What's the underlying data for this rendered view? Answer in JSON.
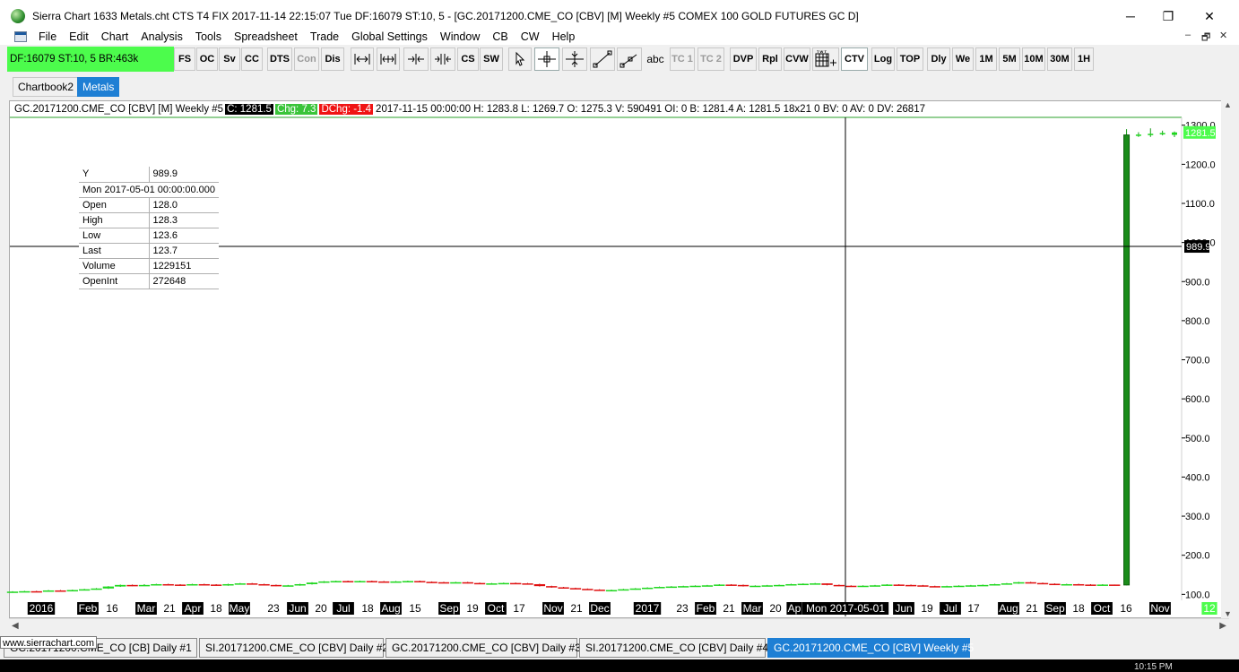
{
  "window": {
    "title": "Sierra Chart 1633 Metals.cht  CTS T4 FIX 2017-11-14  22:15:07 Tue  DF:16079  ST:10, 5 - [GC.20171200.CME_CO [CBV] [M]  Weekly  #5  COMEX 100 GOLD FUTURES GC D]",
    "minimize": "─",
    "maximize": "❐",
    "close": "✕"
  },
  "menu": [
    "File",
    "Edit",
    "Chart",
    "Analysis",
    "Tools",
    "Spreadsheet",
    "Trade",
    "Global Settings",
    "Window",
    "CB",
    "CW",
    "Help"
  ],
  "mdi_controls": [
    "–",
    "🗗",
    "✕"
  ],
  "status_box": "DF:16079  ST:10, 5  BR:463k",
  "toolbar": {
    "buttons": [
      "FS",
      "OC",
      "Sv",
      "CC",
      "DTS",
      "Con",
      "Dis",
      "CS",
      "SW",
      "abc",
      "TC 1",
      "TC 2",
      "DVP",
      "Rpl",
      "CVW",
      "CTV",
      "Log",
      "TOP",
      "Dly",
      "We",
      "1M",
      "5M",
      "10M",
      "30M",
      "1H"
    ],
    "disabled": [
      "Con",
      "TC 1",
      "TC 2"
    ],
    "selected": [
      "CTV"
    ],
    "icons": [
      "fit-width-icon",
      "expand-width-icon",
      "scale-left-icon",
      "scale-right-icon",
      "pointer-icon",
      "crosshair-icon",
      "value-crosshair-icon",
      "line-icon",
      "ray-icon",
      "calendar-icon"
    ]
  },
  "chartbook_tabs": [
    {
      "label": "Chartbook2",
      "active": false
    },
    {
      "label": "Metals",
      "active": true
    }
  ],
  "header": {
    "symbol": "GC.20171200.CME_CO [CBV] [M]  Weekly  #5",
    "close": "C: 1281.5",
    "change": "Chg: 7.3",
    "dchange": "DChg: -1.4",
    "rest": "2017-11-15 00:00:00 H: 1283.8 L: 1269.7 O: 1275.3 V: 590491 OI: 0 B: 1281.4 A: 1281.5 18x21 0 BV: 0 AV: 0 DV: 26817"
  },
  "data_window": [
    [
      "Y",
      "989.9"
    ],
    [
      "Mon 2017-05-01  00:00:00.000",
      ""
    ],
    [
      "Open",
      "128.0"
    ],
    [
      "High",
      "128.3"
    ],
    [
      "Low",
      "123.6"
    ],
    [
      "Last",
      "123.7"
    ],
    [
      "Volume",
      "1229151"
    ],
    [
      "OpenInt",
      "272648"
    ]
  ],
  "chart_data": {
    "type": "bar",
    "title": "GC.20171200.CME_CO [CBV] [M]  Weekly  #5",
    "ylim": [
      87,
      1320
    ],
    "y_ticks": [
      "1300.0",
      "1200.0",
      "1100.0",
      "1000.0",
      "900.0",
      "800.0",
      "700.0",
      "600.0",
      "500.0",
      "400.0",
      "300.0",
      "200.0",
      "100.0"
    ],
    "last_price_label": "1281.5",
    "crosshair_y_label": "989.9",
    "crosshair_y_value": 989.9,
    "crosshair_x_label": "Mon 2017-05-01",
    "x_labels": [
      {
        "t": "2016",
        "hl": true
      },
      {
        "t": "Feb",
        "hl": true
      },
      {
        "t": "16",
        "hl": false
      },
      {
        "t": "Mar",
        "hl": true
      },
      {
        "t": "21",
        "hl": false
      },
      {
        "t": "Apr",
        "hl": true
      },
      {
        "t": "18",
        "hl": false
      },
      {
        "t": "May",
        "hl": true
      },
      {
        "t": "23",
        "hl": false
      },
      {
        "t": "Jun",
        "hl": true
      },
      {
        "t": "20",
        "hl": false
      },
      {
        "t": "Jul",
        "hl": true
      },
      {
        "t": "18",
        "hl": false
      },
      {
        "t": "Aug",
        "hl": true
      },
      {
        "t": "15",
        "hl": false
      },
      {
        "t": "Sep",
        "hl": true
      },
      {
        "t": "19",
        "hl": false
      },
      {
        "t": "Oct",
        "hl": true
      },
      {
        "t": "17",
        "hl": false
      },
      {
        "t": "Nov",
        "hl": true
      },
      {
        "t": "21",
        "hl": false
      },
      {
        "t": "Dec",
        "hl": true
      },
      {
        "t": "2017",
        "hl": true
      },
      {
        "t": "23",
        "hl": false
      },
      {
        "t": "Feb",
        "hl": true
      },
      {
        "t": "21",
        "hl": false
      },
      {
        "t": "Mar",
        "hl": true
      },
      {
        "t": "20",
        "hl": false
      },
      {
        "t": "Ap",
        "hl": true
      },
      {
        "t": "Mon 2017-05-01",
        "hl": true
      },
      {
        "t": "Jun",
        "hl": true
      },
      {
        "t": "19",
        "hl": false
      },
      {
        "t": "Jul",
        "hl": true
      },
      {
        "t": "17",
        "hl": false
      },
      {
        "t": "Aug",
        "hl": true
      },
      {
        "t": "21",
        "hl": false
      },
      {
        "t": "Sep",
        "hl": true
      },
      {
        "t": "18",
        "hl": false
      },
      {
        "t": "Oct",
        "hl": true
      },
      {
        "t": "16",
        "hl": false
      },
      {
        "t": "Nov",
        "hl": true
      },
      {
        "t": "12",
        "hl": false
      }
    ],
    "bars": [
      {
        "o": 106,
        "c": 107,
        "h": 108,
        "l": 105
      },
      {
        "o": 107,
        "c": 108,
        "h": 109,
        "l": 106
      },
      {
        "o": 108,
        "c": 107,
        "h": 109,
        "l": 106
      },
      {
        "o": 108,
        "c": 110,
        "h": 111,
        "l": 107
      },
      {
        "o": 110,
        "c": 109,
        "h": 111,
        "l": 108
      },
      {
        "o": 109,
        "c": 111,
        "h": 112,
        "l": 108
      },
      {
        "o": 111,
        "c": 113,
        "h": 114,
        "l": 110
      },
      {
        "o": 113,
        "c": 115,
        "h": 116,
        "l": 112
      },
      {
        "o": 115,
        "c": 120,
        "h": 121,
        "l": 114
      },
      {
        "o": 120,
        "c": 124,
        "h": 125,
        "l": 119
      },
      {
        "o": 124,
        "c": 123,
        "h": 125,
        "l": 121
      },
      {
        "o": 123,
        "c": 124,
        "h": 126,
        "l": 122
      },
      {
        "o": 124,
        "c": 126,
        "h": 127,
        "l": 123
      },
      {
        "o": 126,
        "c": 125,
        "h": 127,
        "l": 123
      },
      {
        "o": 125,
        "c": 124,
        "h": 126,
        "l": 122
      },
      {
        "o": 124,
        "c": 126,
        "h": 127,
        "l": 123
      },
      {
        "o": 126,
        "c": 125,
        "h": 127,
        "l": 124
      },
      {
        "o": 125,
        "c": 123,
        "h": 126,
        "l": 122
      },
      {
        "o": 123,
        "c": 126,
        "h": 127,
        "l": 122
      },
      {
        "o": 126,
        "c": 128,
        "h": 129,
        "l": 125
      },
      {
        "o": 128,
        "c": 126,
        "h": 129,
        "l": 125
      },
      {
        "o": 126,
        "c": 124,
        "h": 127,
        "l": 123
      },
      {
        "o": 124,
        "c": 122,
        "h": 125,
        "l": 121
      },
      {
        "o": 122,
        "c": 123,
        "h": 124,
        "l": 121
      },
      {
        "o": 123,
        "c": 126,
        "h": 127,
        "l": 122
      },
      {
        "o": 126,
        "c": 130,
        "h": 131,
        "l": 125
      },
      {
        "o": 130,
        "c": 133,
        "h": 134,
        "l": 129
      },
      {
        "o": 133,
        "c": 134,
        "h": 135,
        "l": 132
      },
      {
        "o": 134,
        "c": 133,
        "h": 135,
        "l": 132
      },
      {
        "o": 133,
        "c": 134,
        "h": 135,
        "l": 132
      },
      {
        "o": 134,
        "c": 133,
        "h": 135,
        "l": 132
      },
      {
        "o": 133,
        "c": 132,
        "h": 134,
        "l": 131
      },
      {
        "o": 132,
        "c": 133,
        "h": 134,
        "l": 131
      },
      {
        "o": 133,
        "c": 134,
        "h": 135,
        "l": 132
      },
      {
        "o": 134,
        "c": 132,
        "h": 135,
        "l": 131
      },
      {
        "o": 132,
        "c": 131,
        "h": 133,
        "l": 130
      },
      {
        "o": 131,
        "c": 130,
        "h": 132,
        "l": 129
      },
      {
        "o": 130,
        "c": 131,
        "h": 132,
        "l": 129
      },
      {
        "o": 131,
        "c": 129,
        "h": 132,
        "l": 128
      },
      {
        "o": 129,
        "c": 127,
        "h": 130,
        "l": 126
      },
      {
        "o": 127,
        "c": 128,
        "h": 129,
        "l": 126
      },
      {
        "o": 128,
        "c": 129,
        "h": 130,
        "l": 127
      },
      {
        "o": 129,
        "c": 128,
        "h": 130,
        "l": 127
      },
      {
        "o": 128,
        "c": 126,
        "h": 129,
        "l": 125
      },
      {
        "o": 126,
        "c": 121,
        "h": 127,
        "l": 120
      },
      {
        "o": 121,
        "c": 118,
        "h": 122,
        "l": 117
      },
      {
        "o": 118,
        "c": 116,
        "h": 119,
        "l": 115
      },
      {
        "o": 116,
        "c": 114,
        "h": 117,
        "l": 113
      },
      {
        "o": 114,
        "c": 112,
        "h": 115,
        "l": 111
      },
      {
        "o": 112,
        "c": 110,
        "h": 113,
        "l": 109
      },
      {
        "o": 110,
        "c": 111,
        "h": 112,
        "l": 109
      },
      {
        "o": 111,
        "c": 113,
        "h": 114,
        "l": 110
      },
      {
        "o": 113,
        "c": 115,
        "h": 116,
        "l": 112
      },
      {
        "o": 115,
        "c": 117,
        "h": 118,
        "l": 114
      },
      {
        "o": 117,
        "c": 119,
        "h": 120,
        "l": 116
      },
      {
        "o": 119,
        "c": 120,
        "h": 121,
        "l": 118
      },
      {
        "o": 120,
        "c": 121,
        "h": 122,
        "l": 119
      },
      {
        "o": 121,
        "c": 122,
        "h": 123,
        "l": 120
      },
      {
        "o": 122,
        "c": 123,
        "h": 124,
        "l": 121
      },
      {
        "o": 123,
        "c": 125,
        "h": 126,
        "l": 122
      },
      {
        "o": 125,
        "c": 124,
        "h": 126,
        "l": 123
      },
      {
        "o": 124,
        "c": 121,
        "h": 125,
        "l": 120
      },
      {
        "o": 121,
        "c": 122,
        "h": 123,
        "l": 120
      },
      {
        "o": 122,
        "c": 123,
        "h": 124,
        "l": 121
      },
      {
        "o": 123,
        "c": 124,
        "h": 125,
        "l": 122
      },
      {
        "o": 124,
        "c": 126,
        "h": 127,
        "l": 123
      },
      {
        "o": 126,
        "c": 127,
        "h": 128,
        "l": 125
      },
      {
        "o": 127,
        "c": 128,
        "h": 129,
        "l": 126
      },
      {
        "o": 128,
        "c": 124,
        "h": 128,
        "l": 123
      },
      {
        "o": 124,
        "c": 122,
        "h": 125,
        "l": 121
      },
      {
        "o": 122,
        "c": 121,
        "h": 123,
        "l": 120
      },
      {
        "o": 121,
        "c": 122,
        "h": 123,
        "l": 120
      },
      {
        "o": 122,
        "c": 123,
        "h": 124,
        "l": 121
      },
      {
        "o": 123,
        "c": 125,
        "h": 126,
        "l": 122
      },
      {
        "o": 125,
        "c": 124,
        "h": 126,
        "l": 123
      },
      {
        "o": 124,
        "c": 123,
        "h": 125,
        "l": 122
      },
      {
        "o": 123,
        "c": 121,
        "h": 124,
        "l": 120
      },
      {
        "o": 121,
        "c": 120,
        "h": 122,
        "l": 119
      },
      {
        "o": 120,
        "c": 121,
        "h": 122,
        "l": 119
      },
      {
        "o": 121,
        "c": 122,
        "h": 123,
        "l": 120
      },
      {
        "o": 122,
        "c": 123,
        "h": 124,
        "l": 121
      },
      {
        "o": 123,
        "c": 124,
        "h": 125,
        "l": 122
      },
      {
        "o": 124,
        "c": 126,
        "h": 127,
        "l": 123
      },
      {
        "o": 126,
        "c": 128,
        "h": 129,
        "l": 125
      },
      {
        "o": 128,
        "c": 131,
        "h": 132,
        "l": 127
      },
      {
        "o": 131,
        "c": 129,
        "h": 132,
        "l": 128
      },
      {
        "o": 129,
        "c": 127,
        "h": 130,
        "l": 126
      },
      {
        "o": 127,
        "c": 125,
        "h": 128,
        "l": 124
      },
      {
        "o": 125,
        "c": 126,
        "h": 127,
        "l": 124
      },
      {
        "o": 126,
        "c": 125,
        "h": 127,
        "l": 124
      },
      {
        "o": 125,
        "c": 124,
        "h": 126,
        "l": 123
      },
      {
        "o": 124,
        "c": 125,
        "h": 126,
        "l": 123
      },
      {
        "o": 125,
        "c": 124,
        "h": 125,
        "l": 123
      },
      {
        "o": 124,
        "c": 1275,
        "h": 1290,
        "l": 123
      },
      {
        "o": 1275,
        "c": 1276,
        "h": 1282,
        "l": 1270
      },
      {
        "o": 1276,
        "c": 1278,
        "h": 1292,
        "l": 1270
      },
      {
        "o": 1278,
        "c": 1280,
        "h": 1286,
        "l": 1274
      },
      {
        "o": 1275.3,
        "c": 1281.5,
        "h": 1283.8,
        "l": 1269.7
      }
    ]
  },
  "sheet_tabs": [
    {
      "label": "GC.20171200.CME_CO [CB]   Daily  #1",
      "active": false
    },
    {
      "label": "SI.20171200.CME_CO [CBV]   Daily  #2",
      "active": false
    },
    {
      "label": "GC.20171200.CME_CO [CBV]   Daily  #3",
      "active": false
    },
    {
      "label": "SI.20171200.CME_CO [CBV]   Daily  #4",
      "active": false
    },
    {
      "label": "GC.20171200.CME_CO [CBV]   Weekly  #5",
      "active": true
    }
  ],
  "tooltip": "www.sierrachart.com",
  "clock": "10:15 PM",
  "scroll": {
    "left": "◀",
    "right": "▶",
    "up": "▲",
    "down": "▼"
  },
  "colors": {
    "up": "#1ed81e",
    "down": "#e01010",
    "status_green": "#4cfc4c",
    "active_tab": "#1e7fd4"
  }
}
